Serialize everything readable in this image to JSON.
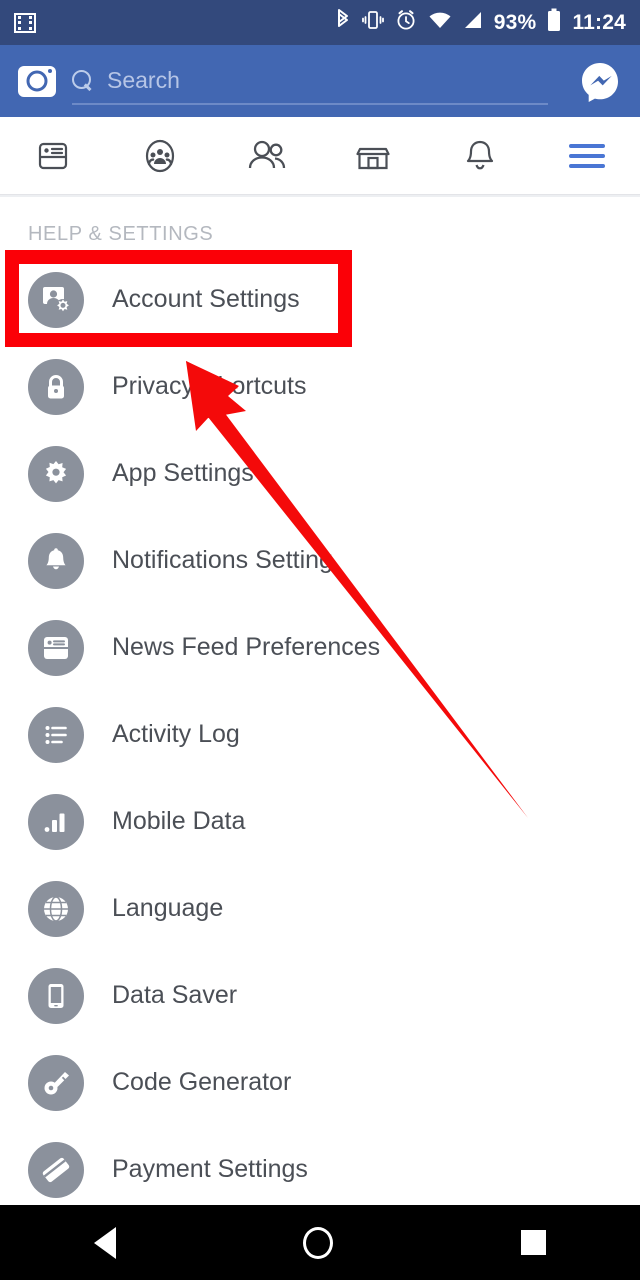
{
  "statusbar": {
    "left_icon": "screen-record-icon",
    "icons": [
      "bluetooth-icon",
      "vibrate-icon",
      "alarm-icon",
      "wifi-icon",
      "cellular-signal-icon"
    ],
    "battery": "93%",
    "time": "11:24"
  },
  "header": {
    "camera_icon": "camera-icon",
    "search_icon": "search-icon",
    "search_placeholder": "Search",
    "search_value": "",
    "messenger_icon": "messenger-icon",
    "bg_color": "#4267B2"
  },
  "tabs": [
    {
      "name": "news-feed",
      "icon": "news-feed-icon",
      "active": false
    },
    {
      "name": "groups",
      "icon": "groups-icon",
      "active": false
    },
    {
      "name": "friends",
      "icon": "friends-icon",
      "active": false
    },
    {
      "name": "marketplace",
      "icon": "marketplace-icon",
      "active": false
    },
    {
      "name": "notifications",
      "icon": "bell-icon",
      "active": false
    },
    {
      "name": "menu",
      "icon": "hamburger-menu-icon",
      "active": true
    }
  ],
  "section": {
    "title": "HELP & SETTINGS"
  },
  "menu_items": [
    {
      "label": "Account Settings",
      "icon": "account-settings-icon",
      "highlighted": true
    },
    {
      "label": "Privacy Shortcuts",
      "icon": "lock-icon",
      "highlighted": false
    },
    {
      "label": "App Settings",
      "icon": "gear-icon",
      "highlighted": false
    },
    {
      "label": "Notifications Setting",
      "icon": "bell-icon",
      "highlighted": false
    },
    {
      "label": "News Feed Preferences",
      "icon": "news-feed-icon",
      "highlighted": false
    },
    {
      "label": "Activity Log",
      "icon": "list-icon",
      "highlighted": false
    },
    {
      "label": "Mobile Data",
      "icon": "bar-chart-icon",
      "highlighted": false
    },
    {
      "label": "Language",
      "icon": "globe-icon",
      "highlighted": false
    },
    {
      "label": "Data Saver",
      "icon": "phone-icon",
      "highlighted": false
    },
    {
      "label": "Code Generator",
      "icon": "key-icon",
      "highlighted": false
    },
    {
      "label": "Payment Settings",
      "icon": "credit-card-icon",
      "highlighted": false
    }
  ],
  "annotation": {
    "highlight_color": "#fb0007",
    "arrow_color": "#f40a0a",
    "target": "Account Settings"
  },
  "navbar": {
    "back": "back-triangle-icon",
    "home": "home-circle-icon",
    "recents": "recents-square-icon"
  },
  "colors": {
    "facebook_blue": "#4267B2",
    "statusbar_blue": "#33497c",
    "icon_gray": "#8b919c",
    "text_gray": "#4b4f56",
    "section_gray": "#b4b8bf"
  }
}
